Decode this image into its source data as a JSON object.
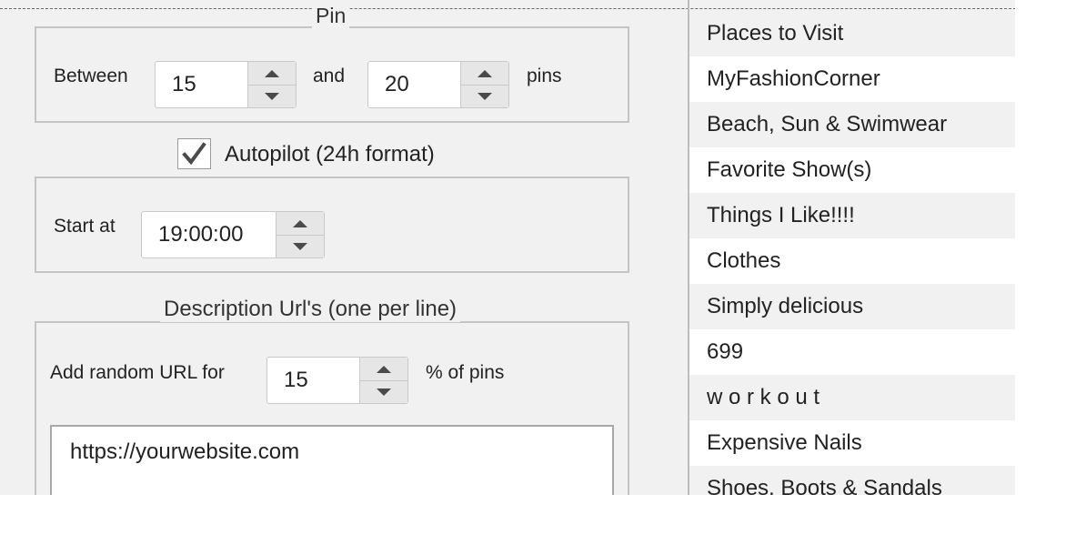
{
  "pin_section": {
    "legend": "Pin",
    "between_label": "Between",
    "min_value": "15",
    "and_label": "and",
    "max_value": "20",
    "pins_label": "pins"
  },
  "autopilot": {
    "checked": true,
    "label": "Autopilot (24h format)",
    "start_label": "Start at",
    "start_time": "19:00:00"
  },
  "description_urls": {
    "legend": "Description Url's (one per line)",
    "random_label": "Add random URL for",
    "percent_value": "15",
    "percent_suffix": "% of pins",
    "urls_text": "https://yourwebsite.com"
  },
  "boards": [
    "Places to Visit",
    "MyFashionCorner",
    "Beach, Sun & Swimwear",
    "Favorite Show(s)",
    "Things I Like!!!!",
    "Clothes",
    "Simply delicious",
    "699",
    "w o r k o u t",
    "Expensive Nails",
    "Shoes, Boots & Sandals"
  ],
  "icons": {
    "checkmark": "check-icon",
    "spinner_up": "arrow-up-icon",
    "spinner_down": "arrow-down-icon"
  }
}
